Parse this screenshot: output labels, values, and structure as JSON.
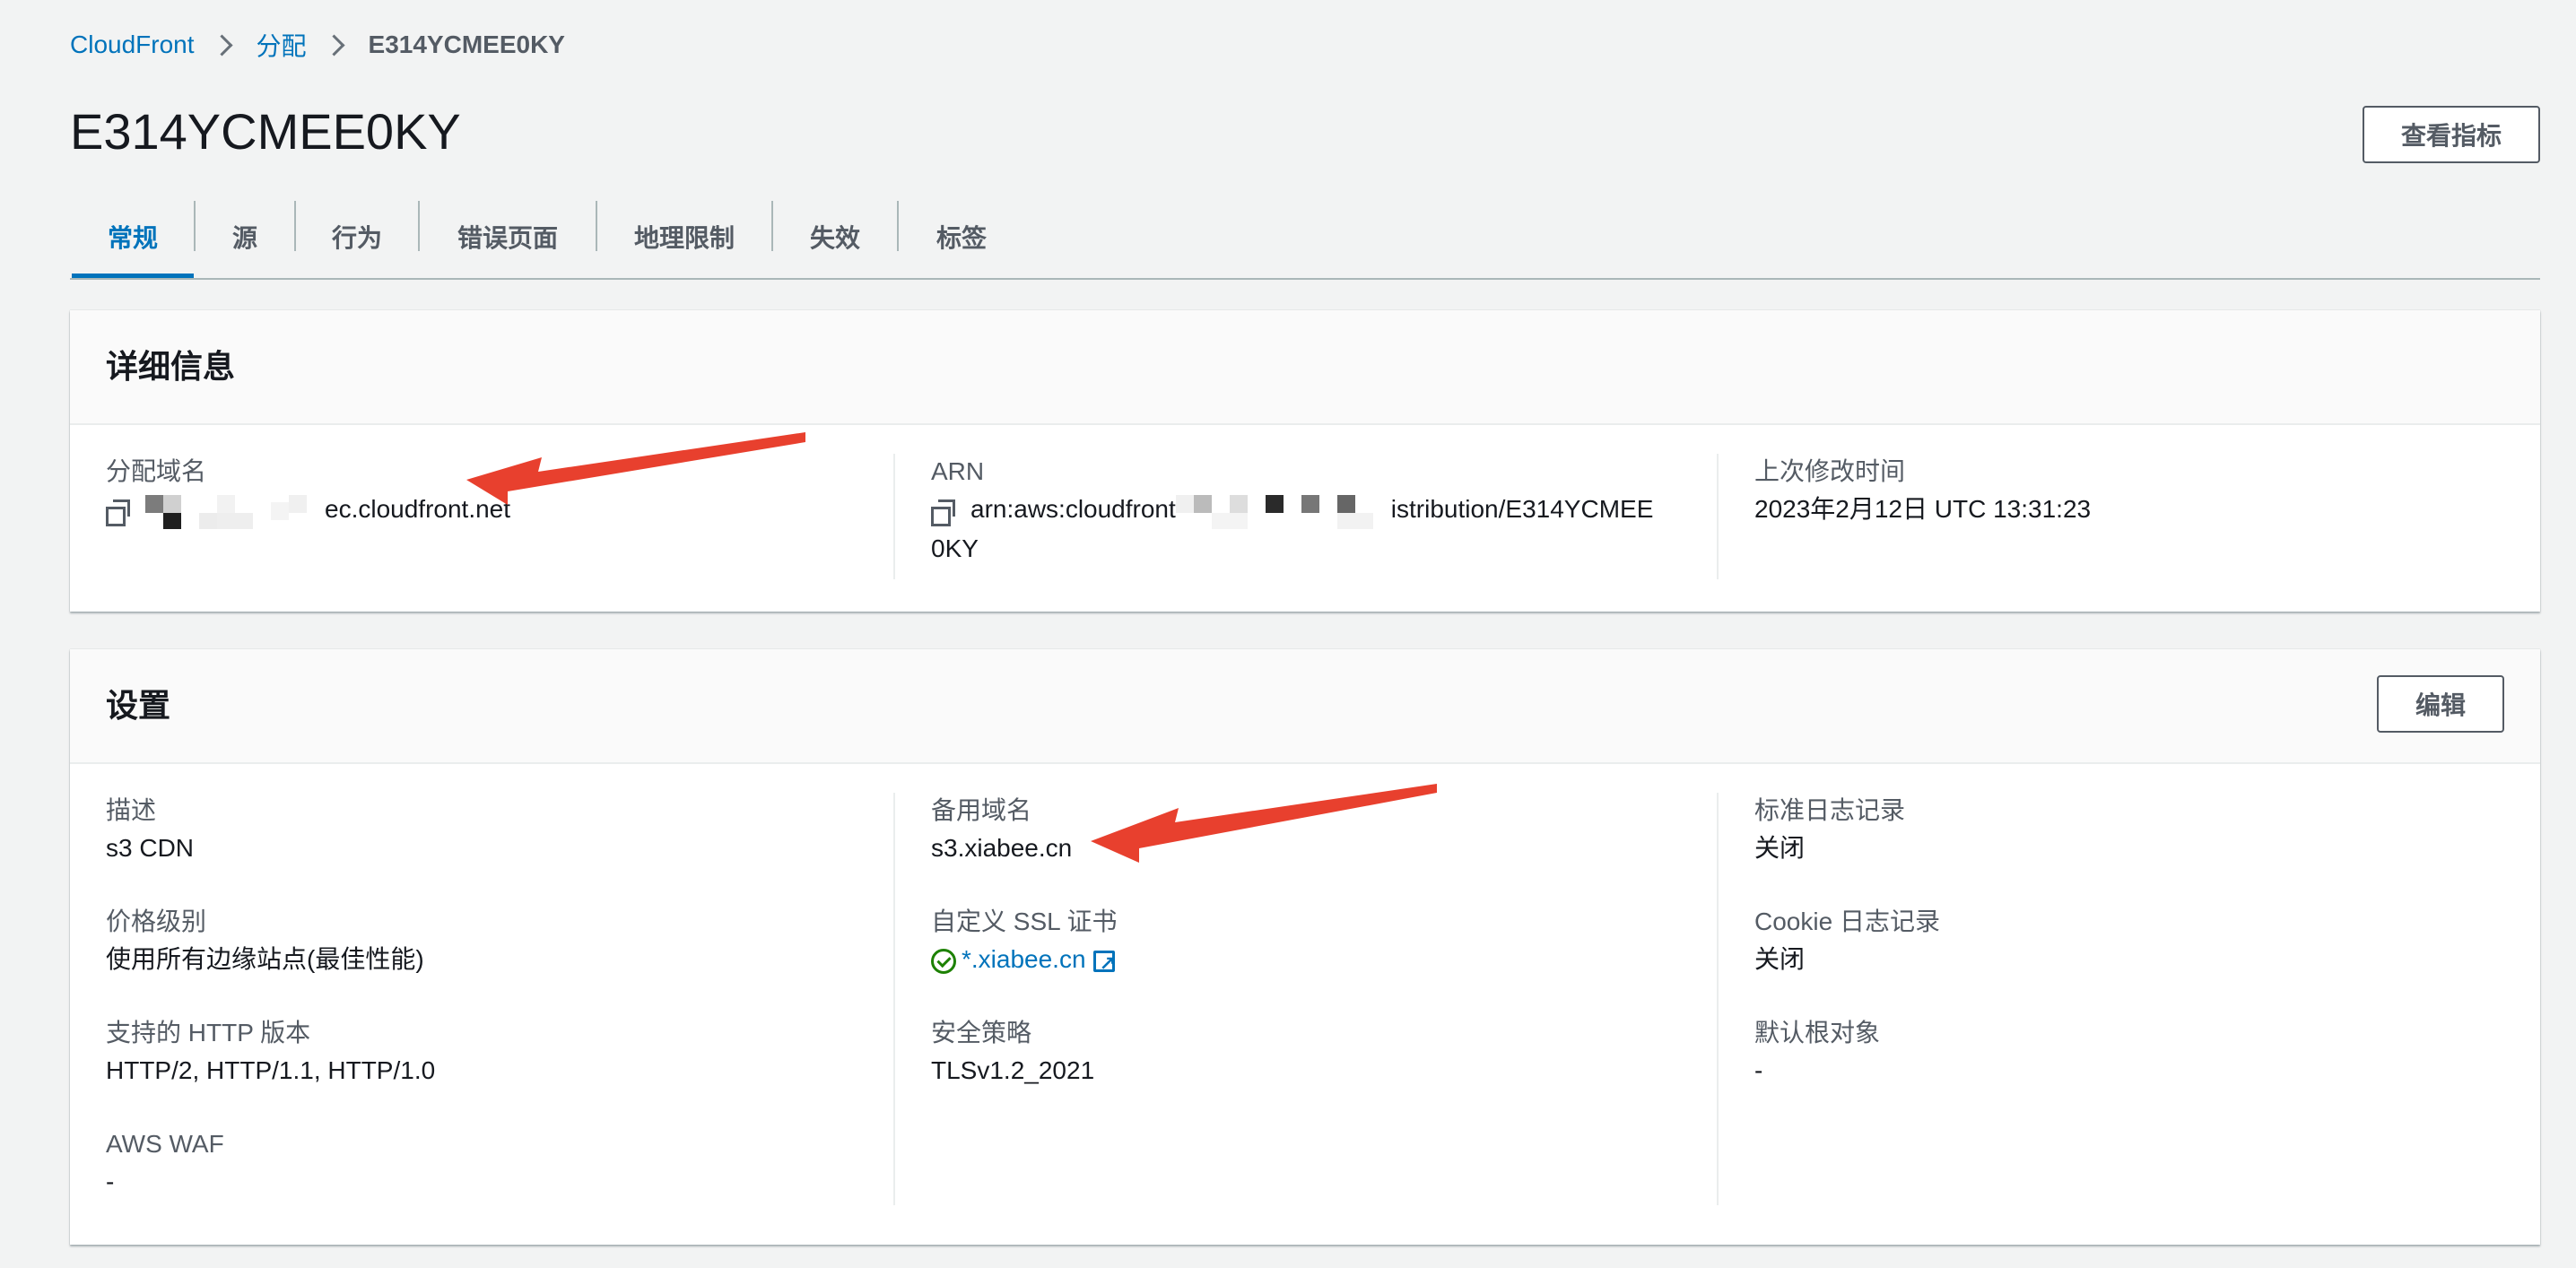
{
  "breadcrumb": {
    "items": [
      "CloudFront",
      "分配"
    ],
    "current": "E314YCMEE0KY"
  },
  "page": {
    "title": "E314YCMEE0KY",
    "metrics_button": "查看指标"
  },
  "tabs": [
    "常规",
    "源",
    "行为",
    "错误页面",
    "地理限制",
    "失效",
    "标签"
  ],
  "details": {
    "title": "详细信息",
    "domain_label": "分配域名",
    "domain_value_suffix": "ec.cloudfront.net",
    "arn_label": "ARN",
    "arn_prefix": "arn:aws:cloudfront",
    "arn_suffix": "istribution/E314YCMEE",
    "arn_line2": "0KY",
    "modified_label": "上次修改时间",
    "modified_value": "2023年2月12日 UTC 13:31:23"
  },
  "settings": {
    "title": "设置",
    "edit_button": "编辑",
    "col1": [
      {
        "label": "描述",
        "value": "s3 CDN"
      },
      {
        "label": "价格级别",
        "value": "使用所有边缘站点(最佳性能)"
      },
      {
        "label": "支持的 HTTP 版本",
        "value": "HTTP/2, HTTP/1.1, HTTP/1.0"
      },
      {
        "label": "AWS WAF",
        "value": "-"
      }
    ],
    "col2": {
      "alt_domain_label": "备用域名",
      "alt_domain_value": "s3.xiabee.cn",
      "ssl_label": "自定义 SSL 证书",
      "ssl_value": "*.xiabee.cn",
      "policy_label": "安全策略",
      "policy_value": "TLSv1.2_2021"
    },
    "col3": [
      {
        "label": "标准日志记录",
        "value": "关闭"
      },
      {
        "label": "Cookie 日志记录",
        "value": "关闭"
      },
      {
        "label": "默认根对象",
        "value": "-"
      }
    ]
  },
  "colors": {
    "link": "#0073bb",
    "annotation_arrow": "#e8402e",
    "success": "#1d8102"
  }
}
